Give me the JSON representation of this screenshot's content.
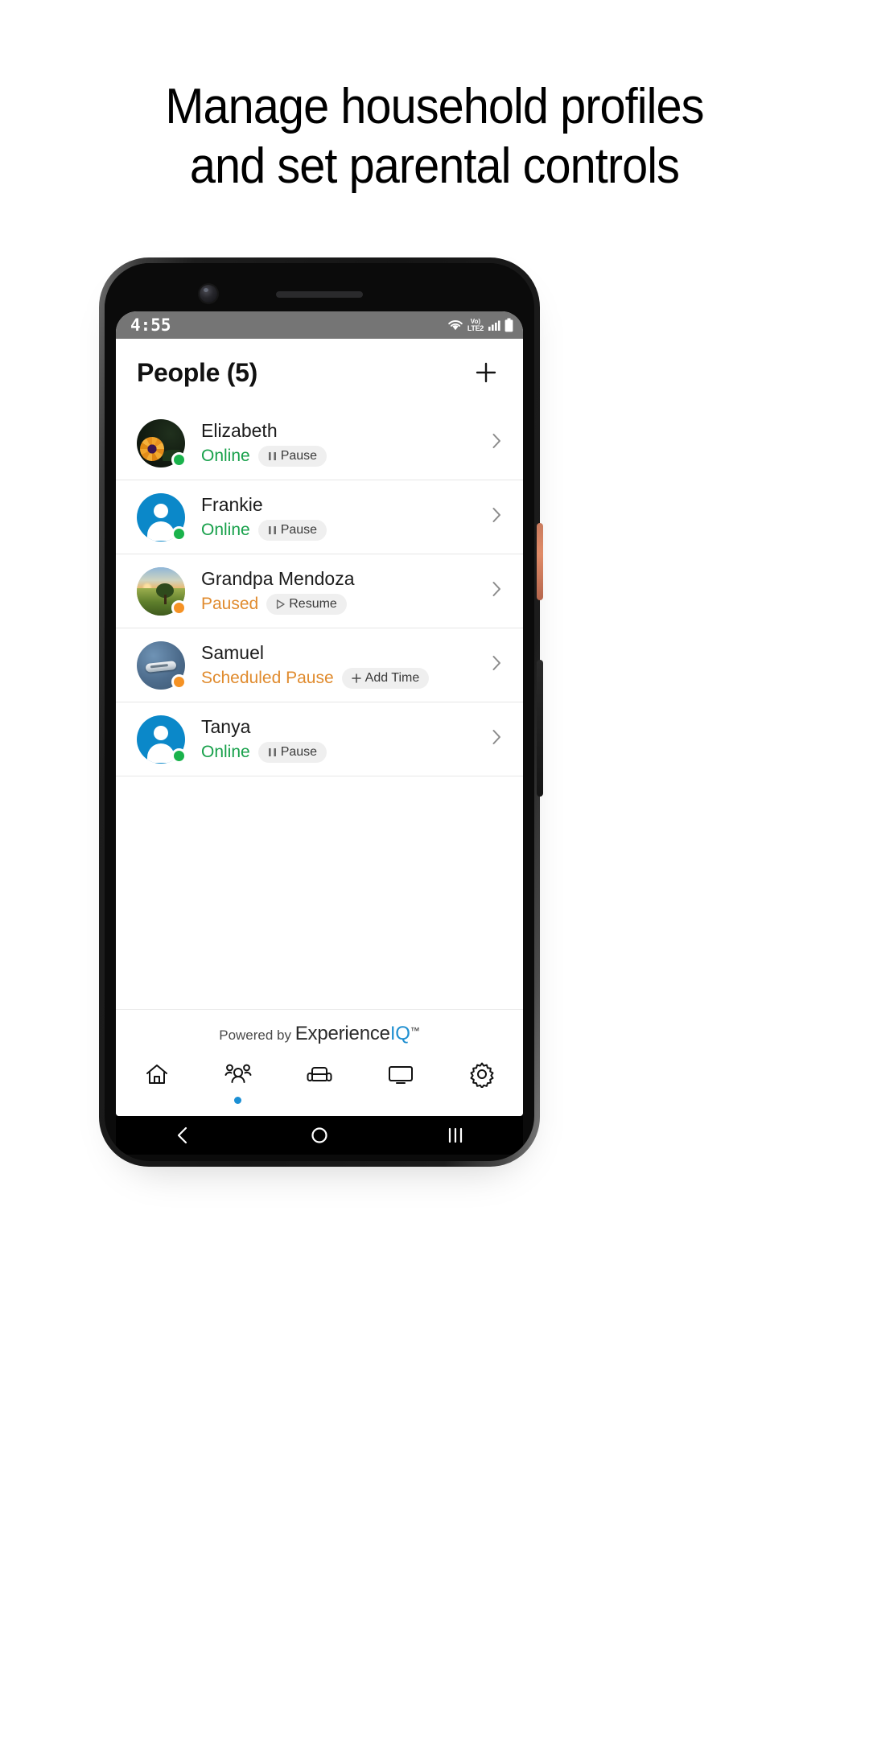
{
  "headline": {
    "line1": "Manage household profiles",
    "line2": "and set parental controls"
  },
  "statusbar": {
    "time": "4:55",
    "wifi_icon": "wifi-icon",
    "volte_top": "Vo)",
    "volte_bottom": "LTE2",
    "signal_icon": "signal-bars-icon",
    "battery_icon": "battery-icon"
  },
  "header": {
    "title": "People (5)",
    "add_label": "+"
  },
  "people": [
    {
      "name": "Elizabeth",
      "status": "Online",
      "status_type": "online",
      "action_label": "Pause",
      "action_glyph": "pause",
      "avatar_type": "flower",
      "chevron": "chevron-right-icon"
    },
    {
      "name": "Frankie",
      "status": "Online",
      "status_type": "online",
      "action_label": "Pause",
      "action_glyph": "pause",
      "avatar_type": "generic",
      "chevron": "chevron-right-icon"
    },
    {
      "name": "Grandpa Mendoza",
      "status": "Paused",
      "status_type": "paused",
      "action_label": "Resume",
      "action_glyph": "play",
      "avatar_type": "landscape",
      "chevron": "chevron-right-icon"
    },
    {
      "name": "Samuel",
      "status": "Scheduled Pause",
      "status_type": "paused",
      "action_label": "Add Time",
      "action_glyph": "plus",
      "avatar_type": "object",
      "chevron": "chevron-right-icon"
    },
    {
      "name": "Tanya",
      "status": "Online",
      "status_type": "online",
      "action_label": "Pause",
      "action_glyph": "pause",
      "avatar_type": "generic",
      "chevron": "chevron-right-icon"
    }
  ],
  "footer": {
    "powered_by": "Powered by ",
    "brand_experience": "Experience",
    "brand_iq": "IQ",
    "trademark": "™"
  },
  "tabs": [
    {
      "icon": "home-icon",
      "active": false
    },
    {
      "icon": "people-icon",
      "active": true
    },
    {
      "icon": "sofa-icon",
      "active": false
    },
    {
      "icon": "monitor-icon",
      "active": false
    },
    {
      "icon": "gear-icon",
      "active": false
    }
  ],
  "navbar": {
    "back": "back-icon",
    "home": "home-circle-icon",
    "recents": "recents-icon"
  },
  "colors": {
    "online_green": "#17a04a",
    "paused_orange": "#e08b2e",
    "accent_blue": "#1b8fd4",
    "avatar_blue": "#0b88c9"
  }
}
